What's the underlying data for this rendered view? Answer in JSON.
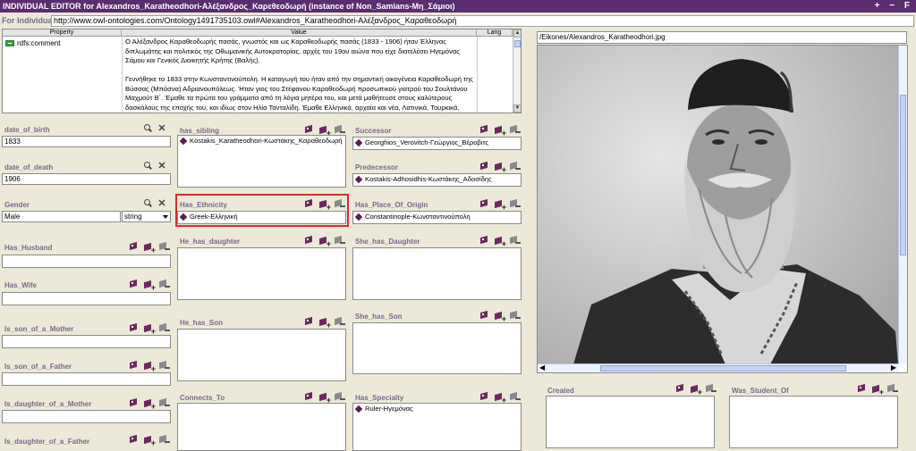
{
  "window": {
    "title": "INDIVIDUAL EDITOR for Alexandros_Karatheodhori-Αλέξανδρος_Καρεθεοδωρή   (instance of Non_Samians-Μη_Σάμιοι)",
    "controls": "+ − F"
  },
  "uri": {
    "label": "For Individual:",
    "value": "http://www.owl-ontologies.com/Ontology1491735103.owl#Alexandros_Karatheodhori-Αλέξανδρος_Καραθεοδωρή"
  },
  "comment_table": {
    "headers": [
      "Property",
      "Value",
      "Lang"
    ],
    "property": "rdfs:comment",
    "value_lines": [
      "Ο Αλέξανδρος Καραθεοδωρής πασάς, γνωστός και ως Καραθεοδωρής πασάς (1833 - 1906) ήταν Έλληνας",
      "διπλωμάτης και πολιτικός της Οθωμανικής Αυτοκρατορίας, αρχές του 19ου αιώνα που είχε διατελέσει Ηγεμόνας",
      "Σάμου και Γενικός Διοικητής Κρήτης (Βαλής).",
      "",
      "Γεννήθηκε το 1833 στην Κωνσταντινούπολη. Η καταγωγή του ήταν από την σημαντική οικογένεια Καραθεοδωρή της",
      "Βύσσας (Μπόσνα) Αδριανουπόλεως. Ήταν γιος του Στέφανου Καραθεοδωρή προσωπικού γιατρού του Σουλτάνου",
      "Μαχμούτ Β΄. Έμαθε τα πρώτα του γράμματα από τη λόγια μητέρα του, και μετά μαθήτευσε στους καλύτερους",
      "δασκάλους της εποχής του, και ιδίως στον Ηλία Τανταλίδη. Έμαθε Ελληνικά, αρχαία και νέα, Λατινικά, Τουρκικά,"
    ]
  },
  "fields": {
    "date_of_birth": {
      "label": "date_of_birth",
      "value": "1833"
    },
    "date_of_death": {
      "label": "date_of_death",
      "value": "1906"
    },
    "gender": {
      "label": "Gender",
      "value": "Male",
      "type": "string"
    },
    "has_husband": {
      "label": "Has_Husband"
    },
    "has_wife": {
      "label": "Has_Wife"
    },
    "is_son_of_a_mother": {
      "label": "Is_son_of_a_Mother"
    },
    "is_son_of_a_father": {
      "label": "Is_son_of_a_Father"
    },
    "is_daughter_of_a_mother": {
      "label": "Is_daughter_of_a_Mother"
    },
    "is_daughter_of_a_father": {
      "label": "Is_daughter_of_a_Father"
    },
    "has_sibling": {
      "label": "has_sibling",
      "items": [
        "Kostakis_Karatheodhori-Κωστάκης_Καραθεοδωρή"
      ]
    },
    "has_ethnicity": {
      "label": "Has_Ethnicity",
      "items": [
        "Greek-Ελληνική"
      ]
    },
    "he_has_daughter": {
      "label": "He_has_daughter"
    },
    "he_has_son": {
      "label": "He_has_Son"
    },
    "connects_to": {
      "label": "Connects_To"
    },
    "successor": {
      "label": "Successor",
      "items": [
        "Georghios_Verovitch-Γεώργιος_Βέροβιτς"
      ]
    },
    "predecessor": {
      "label": "Predecessor",
      "items": [
        "Kostakis-Adhosidhis-Κωστάκης_Αδοσίδης"
      ]
    },
    "has_place_of_origin": {
      "label": "Has_Place_Of_Origin",
      "items": [
        "Constantinople-Κωνσταντινούπολη"
      ]
    },
    "she_has_daughter": {
      "label": "She_has_Daughter"
    },
    "she_has_son": {
      "label": "She_has_Son"
    },
    "has_specialty": {
      "label": "Has_Specialty",
      "items": [
        "Ruler-Ηγεμόνας"
      ]
    },
    "created": {
      "label": "Created"
    },
    "was_student_of": {
      "label": "Was_Student_Of"
    }
  },
  "image": {
    "path": "/Eikones/Alexandros_Karatheodhori.jpg"
  },
  "colors": {
    "titlebar": "#5a2d6e",
    "label": "#7a6a8a",
    "highlight": "#d32f2f",
    "diamond": "#5a1f4e"
  },
  "icons": [
    "search-icon",
    "delete-icon",
    "view-instance-icon",
    "add-instance-icon",
    "remove-instance-icon",
    "diamond-icon",
    "comment-icon"
  ]
}
